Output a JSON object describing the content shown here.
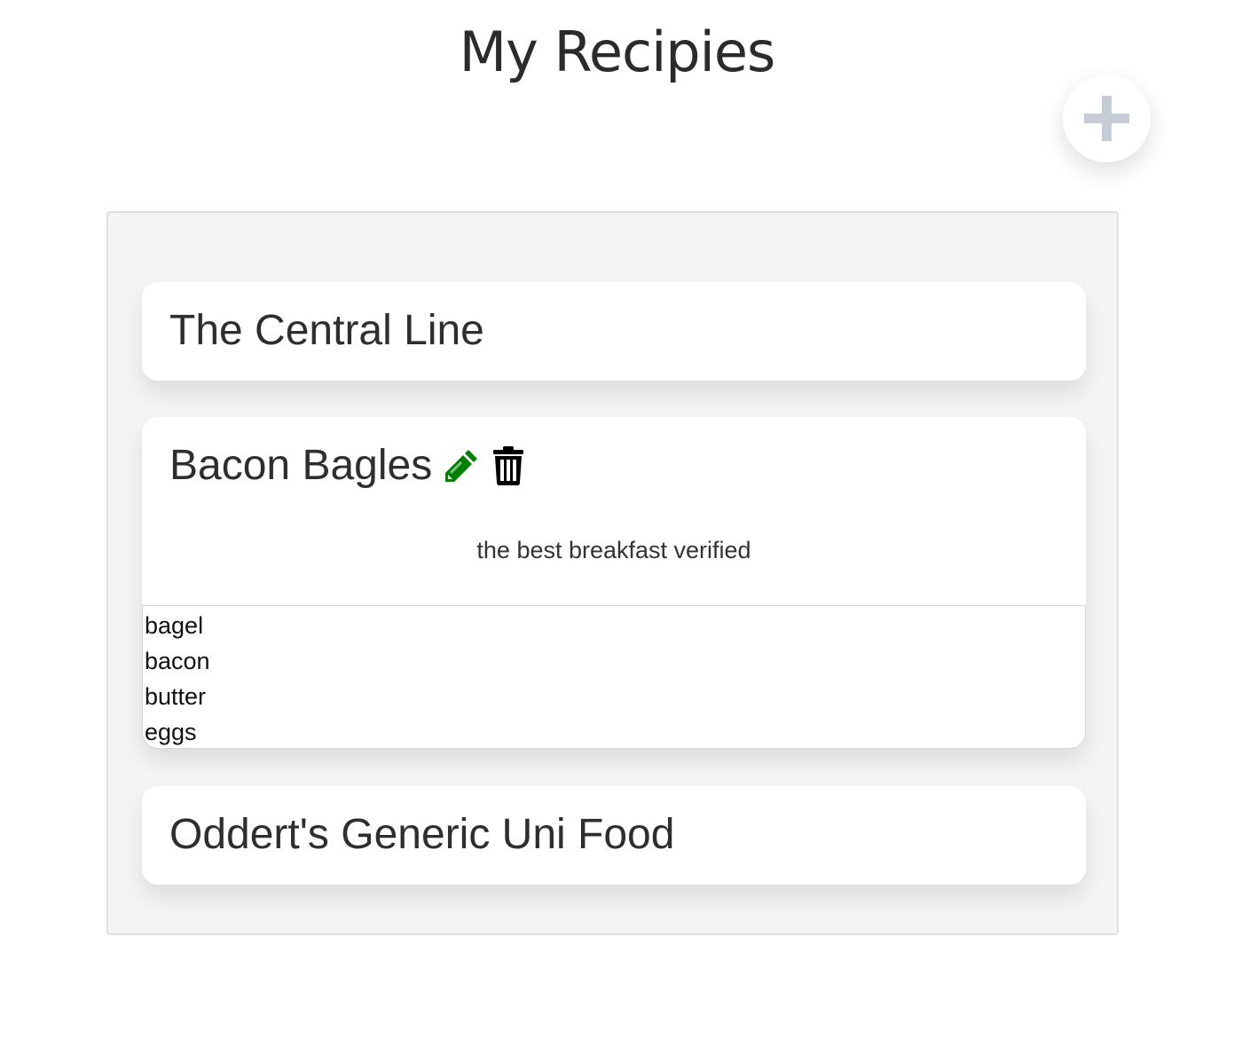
{
  "header": {
    "title": "My Recipies",
    "add_icon": "plus-icon"
  },
  "recipes": [
    {
      "title": "The Central Line",
      "expanded": false
    },
    {
      "title": "Bacon Bagles",
      "expanded": true,
      "edit_icon": "pencil-icon",
      "delete_icon": "trash-icon",
      "description": "the best breakfast verified",
      "ingredients": [
        "bagel",
        "bacon",
        "butter",
        "eggs"
      ]
    },
    {
      "title": "Oddert's Generic Uni Food",
      "expanded": false
    }
  ],
  "colors": {
    "edit_icon": "#008000",
    "delete_icon": "#000000",
    "add_icon": "#c5ccd3",
    "panel_background": "#f4f4f4"
  }
}
